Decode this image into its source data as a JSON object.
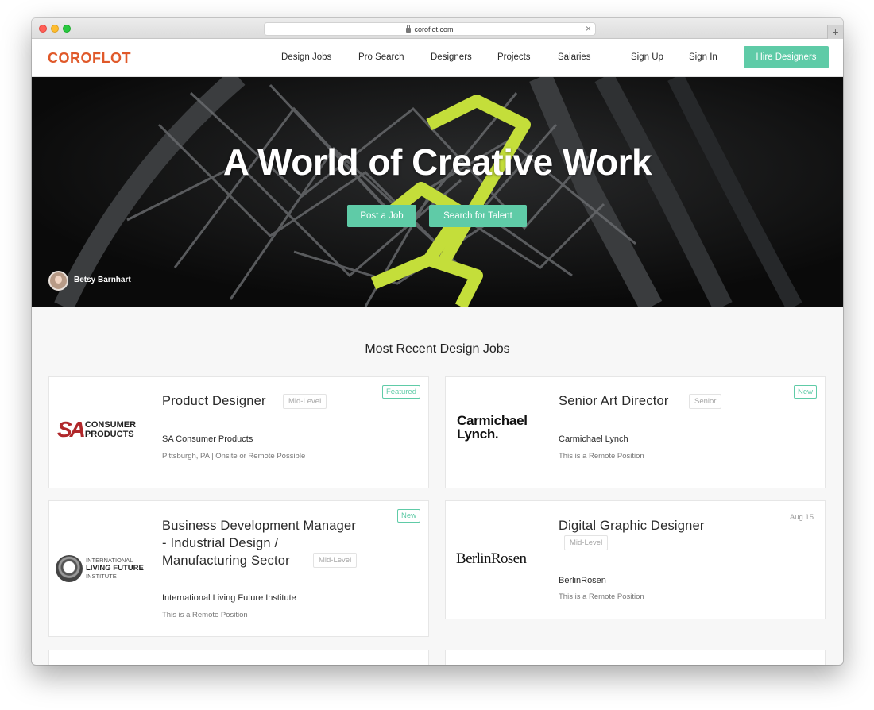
{
  "browser": {
    "url": "coroflot.com"
  },
  "site": {
    "logo": "COROFLOT",
    "nav": [
      "Design Jobs",
      "Pro Search",
      "Designers",
      "Projects",
      "Salaries",
      "Sign Up",
      "Sign In"
    ],
    "hire_label": "Hire Designers",
    "accent": "#5fcba7",
    "brand": "#e0592a"
  },
  "hero": {
    "title": "A World of Creative Work",
    "post_job_label": "Post a Job",
    "search_talent_label": "Search for Talent",
    "credit": "Betsy Barnhart"
  },
  "section_title": "Most Recent Design Jobs",
  "jobs": [
    {
      "title": "Product Designer",
      "level": "Mid-Level",
      "badge": "Featured",
      "company": "SA Consumer Products",
      "location": "Pittsburgh, PA | Onsite or Remote Possible",
      "logo_sa": "SA",
      "logo_line1": "CONSUMER",
      "logo_line2": "PRODUCTS"
    },
    {
      "title": "Senior Art Director",
      "level": "Senior",
      "badge": "New",
      "company": "Carmichael Lynch",
      "location": "This is a Remote Position",
      "logo_line1": "Carmichael",
      "logo_line2": "Lynch."
    },
    {
      "title_line1": "Business Development Manager",
      "title_line2": "- Industrial Design /",
      "title_line3": "Manufacturing Sector",
      "level": "Mid-Level",
      "badge": "New",
      "company": "International Living Future Institute",
      "location": "This is a Remote Position",
      "logo_line1": "INTERNATIONAL",
      "logo_line2": "LIVING FUTURE",
      "logo_line3": "INSTITUTE"
    },
    {
      "title": "Digital Graphic Designer",
      "level": "Mid-Level",
      "date": "Aug 15",
      "company": "BerlinRosen",
      "location": "This is a Remote Position",
      "logo_text": "BerlinRosen"
    }
  ]
}
